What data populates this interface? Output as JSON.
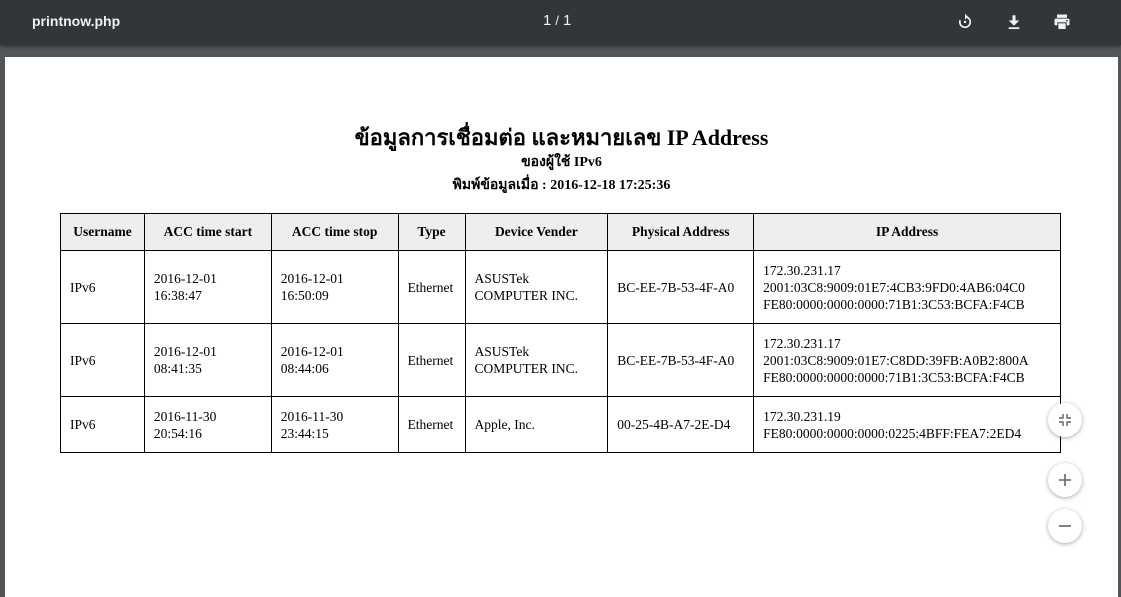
{
  "toolbar": {
    "title": "printnow.php",
    "page_current": "1",
    "page_separator": "/",
    "page_total": "1",
    "icons": [
      "rotate-icon",
      "download-icon",
      "print-icon"
    ]
  },
  "document": {
    "title": "ข้อมูลการเชื่อมต่อ และหมายเลข IP Address",
    "subtitle": "ของผู้ใช้ IPv6",
    "printed_line": "พิมพ์ข้อมูลเมื่อ : 2016-12-18 17:25:36",
    "table": {
      "headers": [
        "Username",
        "ACC time start",
        "ACC time stop",
        "Type",
        "Device Vender",
        "Physical Address",
        "IP Address"
      ],
      "rows": [
        {
          "username": "IPv6",
          "start_date": "2016-12-01",
          "start_time": "16:38:47",
          "stop_date": "2016-12-01",
          "stop_time": "16:50:09",
          "type": "Ethernet",
          "vendor_line1": "ASUSTek",
          "vendor_line2": "COMPUTER INC.",
          "mac": "BC-EE-7B-53-4F-A0",
          "ip1": "172.30.231.17",
          "ip2": "2001:03C8:9009:01E7:4CB3:9FD0:4AB6:04C0",
          "ip3": "FE80:0000:0000:0000:71B1:3C53:BCFA:F4CB"
        },
        {
          "username": "IPv6",
          "start_date": "2016-12-01",
          "start_time": "08:41:35",
          "stop_date": "2016-12-01",
          "stop_time": "08:44:06",
          "type": "Ethernet",
          "vendor_line1": "ASUSTek",
          "vendor_line2": "COMPUTER INC.",
          "mac": "BC-EE-7B-53-4F-A0",
          "ip1": "172.30.231.17",
          "ip2": "2001:03C8:9009:01E7:C8DD:39FB:A0B2:800A",
          "ip3": "FE80:0000:0000:0000:71B1:3C53:BCFA:F4CB"
        },
        {
          "username": "IPv6",
          "start_date": "2016-11-30",
          "start_time": "20:54:16",
          "stop_date": "2016-11-30",
          "stop_time": "23:44:15",
          "type": "Ethernet",
          "vendor_line1": "Apple, Inc.",
          "vendor_line2": "",
          "mac": "00-25-4B-A7-2E-D4",
          "ip1": "172.30.231.19",
          "ip2": "FE80:0000:0000:0000:0225:4BFF:FEA7:2ED4",
          "ip3": ""
        }
      ]
    }
  },
  "zoom_controls": [
    "fit-to-page-icon",
    "zoom-in-icon",
    "zoom-out-icon"
  ]
}
